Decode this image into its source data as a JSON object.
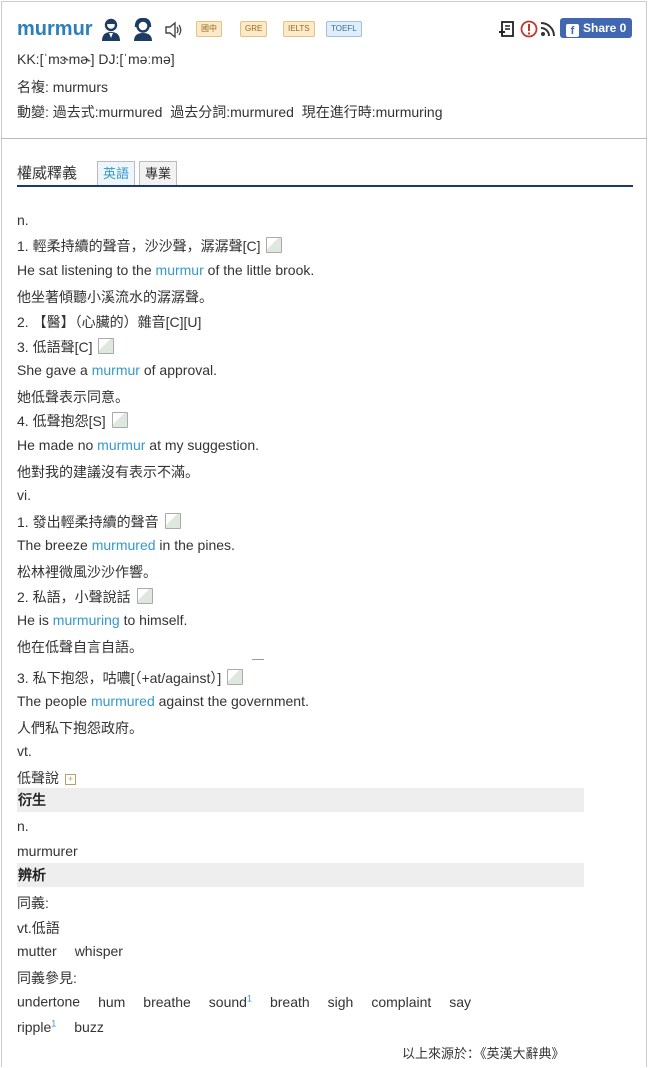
{
  "header": {
    "word": "murmur",
    "badges": [
      "國中",
      "GRE",
      "IELTS",
      "TOEFL"
    ],
    "share_label": "Share 0",
    "phonetic": "KK:[ˈmɝmɚ] DJ:[ˈməːmə]",
    "plural": "名複: murmurs",
    "inflections": "動變: 過去式:murmured  過去分詞:murmured  現在進行時:murmuring"
  },
  "section": {
    "title": "權威釋義",
    "tabs": [
      "英語",
      "專業"
    ]
  },
  "entries": {
    "pos_n": "n.",
    "n1_def": "1. 輕柔持續的聲音，沙沙聲，潺潺聲[C]",
    "n1_ex_pre": "He sat listening to the ",
    "n1_ex_kw": "murmur",
    "n1_ex_post": " of the little brook.",
    "n1_zh": "他坐著傾聽小溪流水的潺潺聲。",
    "n2_def": "2. 【醫】（心臟的）雜音[C][U]",
    "n3_def": "3. 低語聲[C]",
    "n3_ex_pre": "She gave a ",
    "n3_ex_kw": "murmur",
    "n3_ex_post": " of approval.",
    "n3_zh": "她低聲表示同意。",
    "n4_def": "4. 低聲抱怨[S]",
    "n4_ex_pre": "He made no ",
    "n4_ex_kw": "murmur",
    "n4_ex_post": " at my suggestion.",
    "n4_zh": "他對我的建議沒有表示不滿。",
    "pos_vi": "vi.",
    "vi1_def": "1. 發出輕柔持續的聲音",
    "vi1_ex_pre": "The breeze ",
    "vi1_ex_kw": "murmured",
    "vi1_ex_post": " in the pines.",
    "vi1_zh": "松林裡微風沙沙作響。",
    "vi2_def": "2. 私語，小聲說話",
    "vi2_ex_pre": "He is ",
    "vi2_ex_kw": "murmuring",
    "vi2_ex_post": " to himself.",
    "vi2_zh": "他在低聲自言自語。",
    "vi3_def": "3. 私下抱怨，咕噥[（+at/against）]",
    "vi3_ex_pre": "The people ",
    "vi3_ex_kw": "murmured",
    "vi3_ex_post": " against the government.",
    "vi3_zh": "人們私下抱怨政府。",
    "pos_vt": "vt.",
    "vt1_def": "低聲說"
  },
  "derivation": {
    "title": "衍生",
    "pos": "n.",
    "word": "murmurer"
  },
  "analysis": {
    "title": "辨析",
    "syn_label": "同義:",
    "syn_pos": "vt.低語",
    "syn_words": [
      "mutter",
      "whisper"
    ],
    "see_also_label": "同義參見:",
    "see_also_row1": [
      "undertone",
      "hum",
      "breathe",
      "sound",
      "breath",
      "sigh",
      "complaint",
      "say"
    ],
    "see_also_row2": [
      "ripple",
      "buzz"
    ],
    "sup_sound": "1",
    "sup_ripple": "1"
  },
  "source": "以上來源於：《英漢大辭典》"
}
